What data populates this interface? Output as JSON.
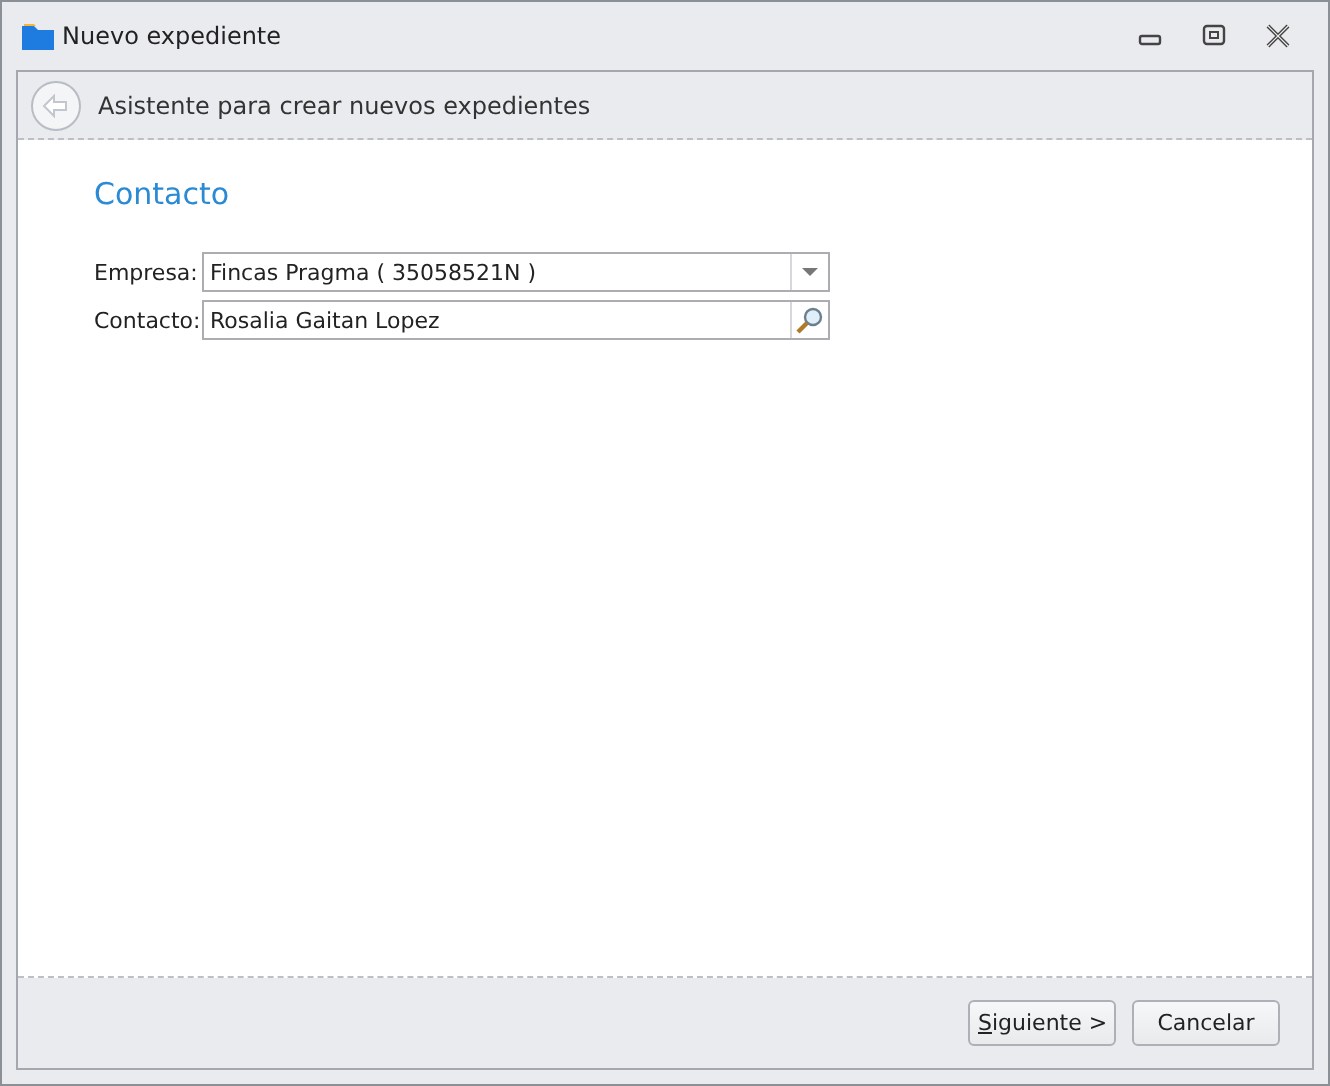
{
  "window": {
    "title": "Nuevo expediente"
  },
  "wizard_header": {
    "title": "Asistente para crear nuevos expedientes"
  },
  "section_title": "Contacto",
  "fields": [
    {
      "kind": "dropdown",
      "label": "Empresa:",
      "value": "Fincas Pragma ( 35058521N )"
    },
    {
      "kind": "lookup",
      "label": "Contacto:",
      "value": "Rosalia Gaitan Lopez"
    }
  ],
  "buttons": [
    {
      "label": "Siguiente >"
    },
    {
      "label": "Cancelar"
    }
  ]
}
